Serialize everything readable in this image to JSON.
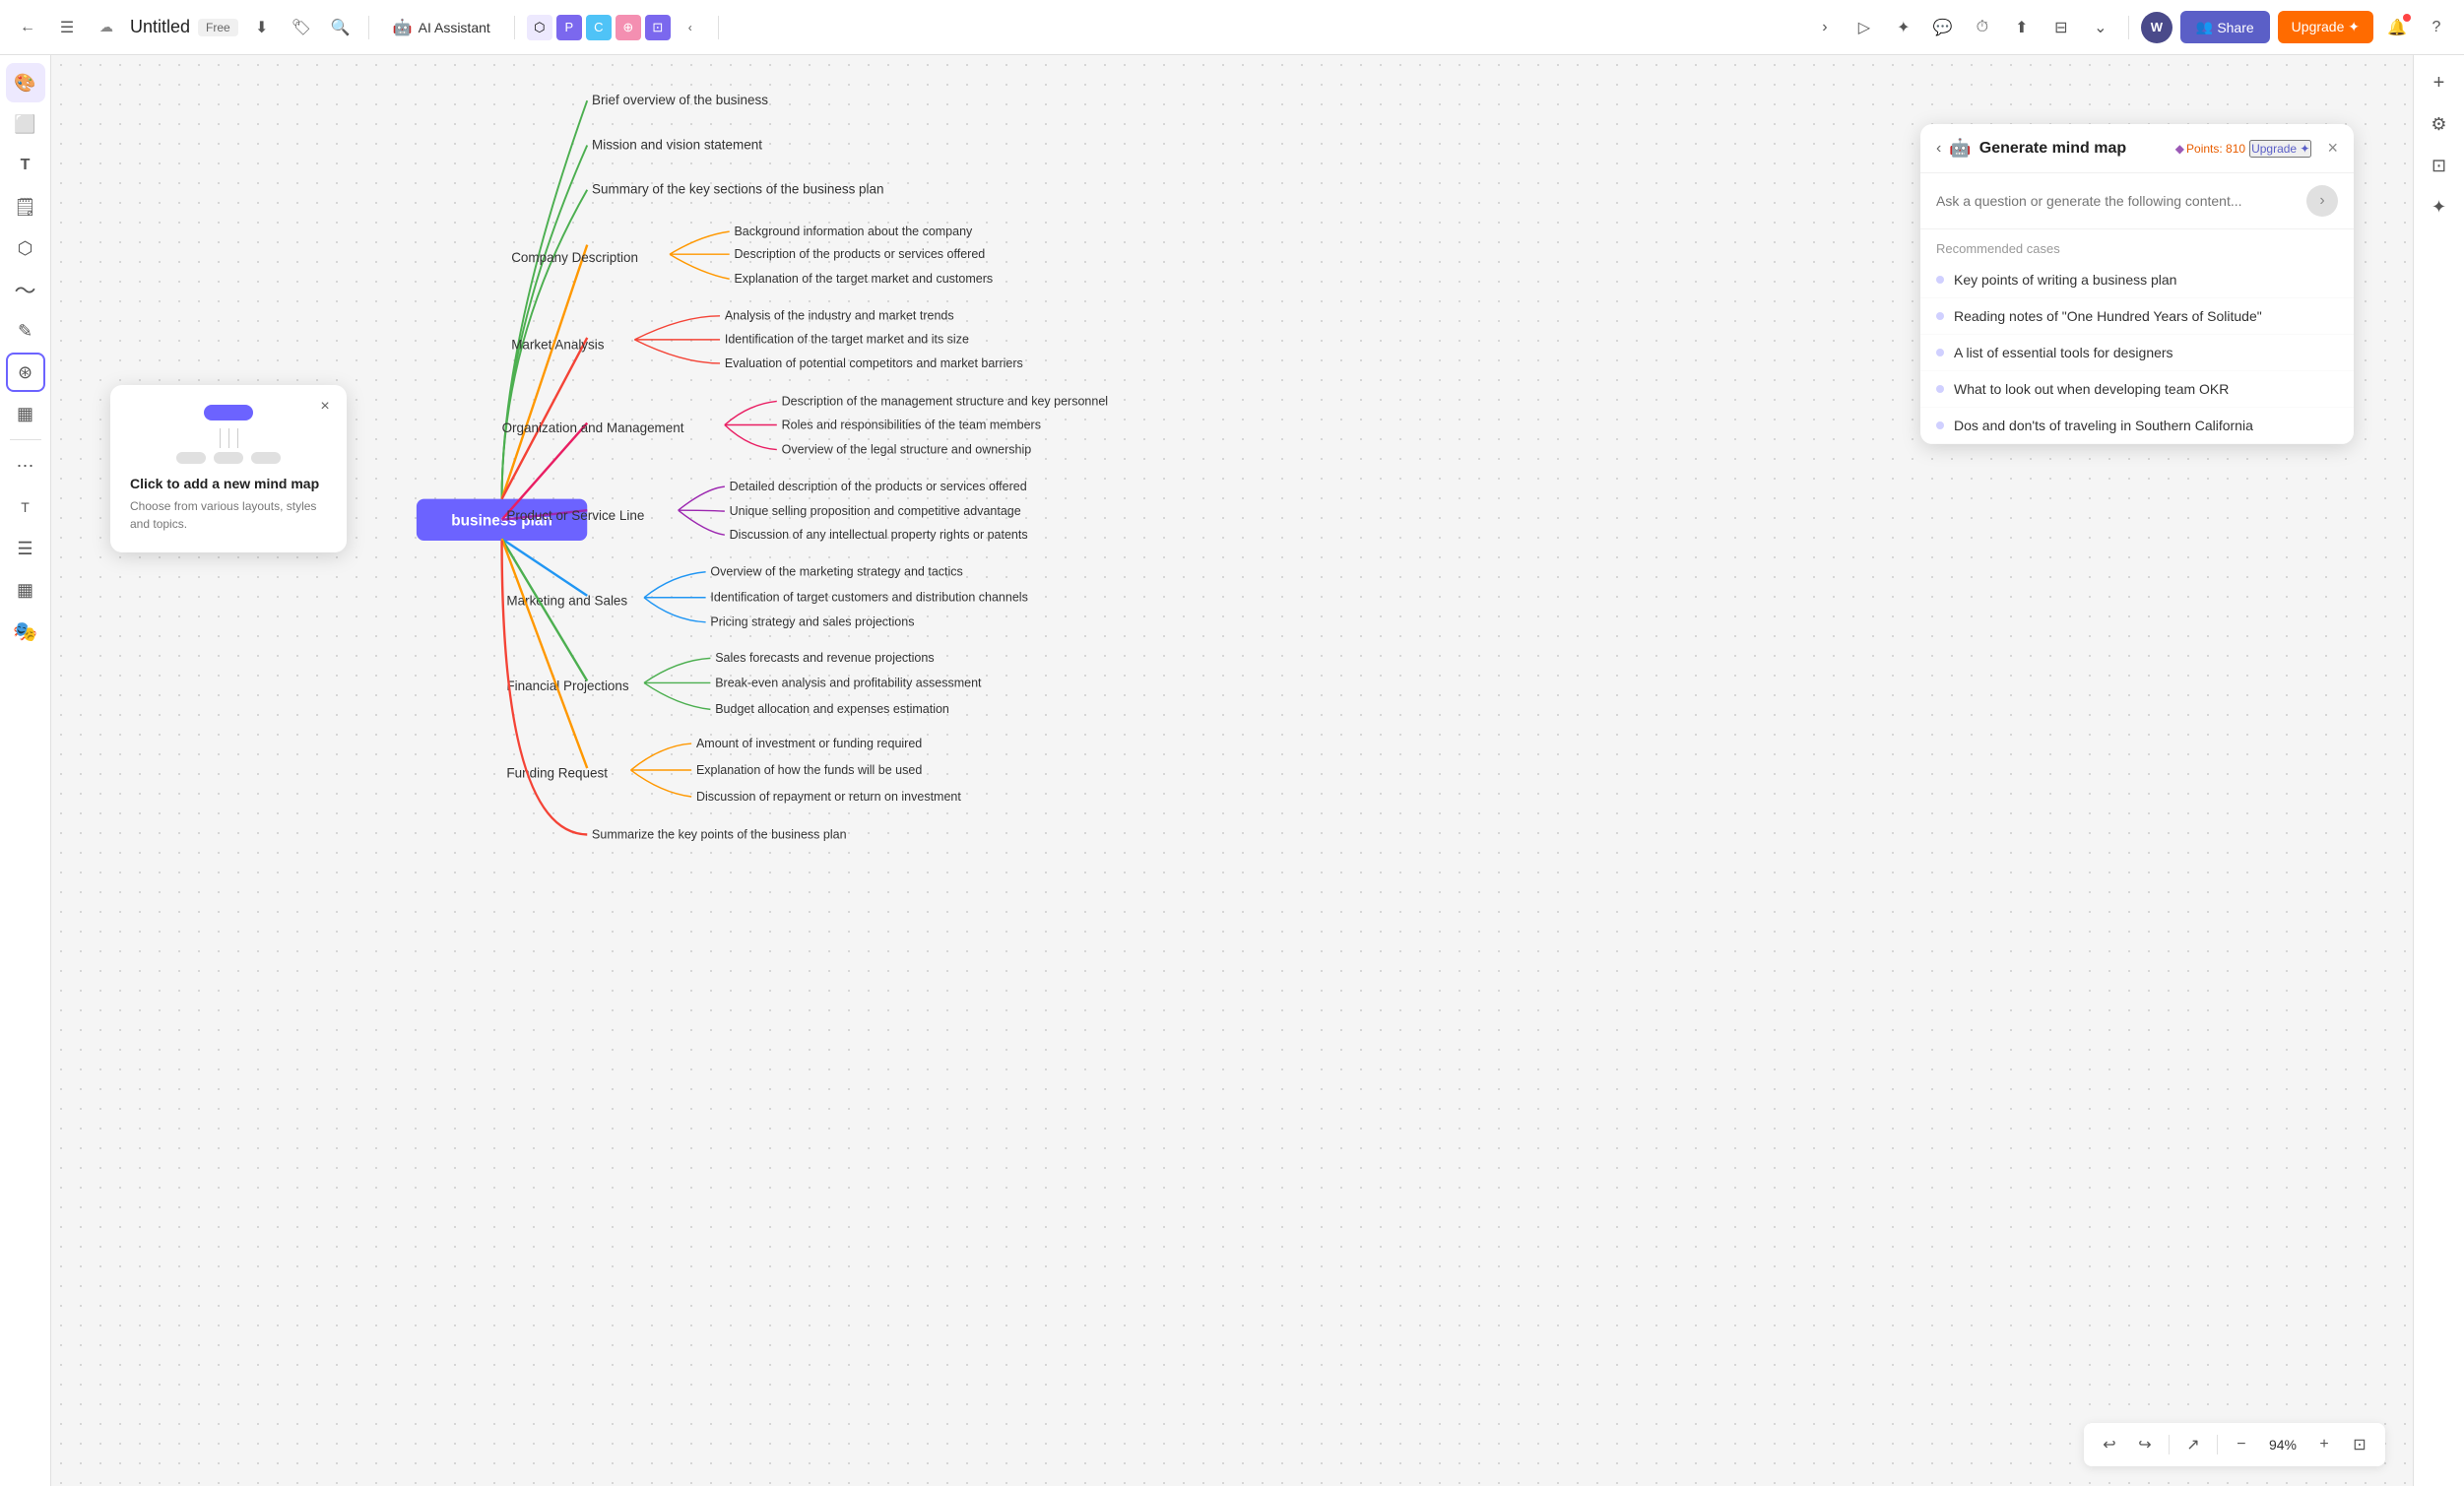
{
  "app": {
    "title": "Untitled",
    "badge": "Free"
  },
  "toolbar": {
    "back_icon": "←",
    "menu_icon": "☰",
    "cloud_icon": "☁",
    "download_icon": "↓",
    "tag_icon": "🏷",
    "search_icon": "🔍",
    "ai_assistant_label": "AI Assistant",
    "more_icon": "›",
    "play_icon": "▷",
    "star_icon": "✦",
    "chat_icon": "💬",
    "timer_icon": "⏱",
    "export_icon": "⬆",
    "filter_icon": "⊟",
    "chevron_icon": "⌄",
    "avatar_label": "W",
    "share_label": "Share",
    "upgrade_label": "Upgrade ✦",
    "bell_icon": "🔔",
    "help_icon": "?"
  },
  "app_icons": [
    {
      "color": "#e8a0ff",
      "letter": ""
    },
    {
      "color": "#7b68ee",
      "letter": "P"
    },
    {
      "color": "#4fc3f7",
      "letter": "C"
    },
    {
      "color": "#f48fb1",
      "letter": ""
    },
    {
      "color": "#7b68ee",
      "letter": ""
    }
  ],
  "left_sidebar": {
    "items": [
      {
        "icon": "🎨",
        "name": "color-palette",
        "active": true
      },
      {
        "icon": "⬜",
        "name": "frame-tool"
      },
      {
        "icon": "T",
        "name": "text-tool"
      },
      {
        "icon": "🗒",
        "name": "sticky-note"
      },
      {
        "icon": "⬡",
        "name": "shape-tool"
      },
      {
        "icon": "〜",
        "name": "pen-tool"
      },
      {
        "icon": "✎",
        "name": "draw-tool"
      },
      {
        "icon": "⊛",
        "name": "mindmap-tool",
        "active_outline": true
      },
      {
        "icon": "▦",
        "name": "table-tool"
      },
      {
        "icon": "⋯",
        "name": "more-tools"
      },
      {
        "icon": "T",
        "name": "text-tool-2"
      },
      {
        "icon": "☰",
        "name": "list-tool"
      },
      {
        "icon": "▦",
        "name": "chart-tool"
      },
      {
        "icon": "⬡⬡",
        "name": "template-tool"
      }
    ]
  },
  "right_sidebar": {
    "items": [
      {
        "icon": "+",
        "name": "add-tool"
      },
      {
        "icon": "⚙",
        "name": "settings-tool"
      },
      {
        "icon": "⊡",
        "name": "frame-right"
      },
      {
        "icon": "✦",
        "name": "effect-tool"
      }
    ]
  },
  "mind_map": {
    "center_label": "business plan",
    "branches": [
      {
        "label": "",
        "color": "#4caf50",
        "items": [
          "Brief overview of the business",
          "Mission and vision statement",
          "Summary of the key sections of the business plan"
        ]
      },
      {
        "label": "Company Description",
        "color": "#ff9800",
        "items": [
          "Background information about the company",
          "Description of the products or services offered",
          "Explanation of the target market and customers"
        ]
      },
      {
        "label": "Market Analysis",
        "color": "#f44336",
        "items": [
          "Analysis of the industry and market trends",
          "Identification of the target market and its size",
          "Evaluation of potential competitors and market barriers"
        ]
      },
      {
        "label": "Organization and Management",
        "color": "#e91e63",
        "items": [
          "Description of the management structure and key personnel",
          "Roles and responsibilities of the team members",
          "Overview of the legal structure and ownership"
        ]
      },
      {
        "label": "Product or Service Line",
        "color": "#9c27b0",
        "items": [
          "Detailed description of the products or services offered",
          "Unique selling proposition and competitive advantage",
          "Discussion of any intellectual property rights or patents"
        ]
      },
      {
        "label": "Marketing and Sales",
        "color": "#2196f3",
        "items": [
          "Overview of the marketing strategy and tactics",
          "Identification of target customers and distribution channels",
          "Pricing strategy and sales projections"
        ]
      },
      {
        "label": "Financial Projections",
        "color": "#4caf50",
        "items": [
          "Sales forecasts and revenue projections",
          "Break-even analysis and profitability assessment",
          "Budget allocation and expenses estimation"
        ]
      },
      {
        "label": "Funding Request",
        "color": "#ff9800",
        "items": [
          "Amount of investment or funding required",
          "Explanation of how the funds will be used",
          "Discussion of repayment or return on investment"
        ]
      },
      {
        "label": "",
        "color": "#f44336",
        "items": [
          "Summarize the key points of the business plan"
        ]
      }
    ]
  },
  "tooltip": {
    "title": "Click to add a new mind map",
    "description": "Choose from various layouts, styles and topics.",
    "close_icon": "×"
  },
  "ai_panel": {
    "back_icon": "‹",
    "title": "Generate mind map",
    "points_icon": "◆",
    "points_value": "Points: 810",
    "upgrade_label": "Upgrade ✦",
    "close_icon": "×",
    "input_placeholder": "Ask a question or generate the following content...",
    "send_icon": "›",
    "recommended_label": "Recommended cases",
    "recommended_items": [
      "Key points of writing a business plan",
      "Reading notes of \"One Hundred Years of Solitude\"",
      "A list of essential tools for designers",
      "What to look out when developing team OKR",
      "Dos and don'ts of traveling in Southern California"
    ]
  },
  "bottom_toolbar": {
    "undo_icon": "↩",
    "redo_icon": "↪",
    "cursor_icon": "⬆",
    "zoom_out_icon": "−",
    "zoom_level": "94%",
    "zoom_in_icon": "+",
    "fit_icon": "⊡"
  }
}
